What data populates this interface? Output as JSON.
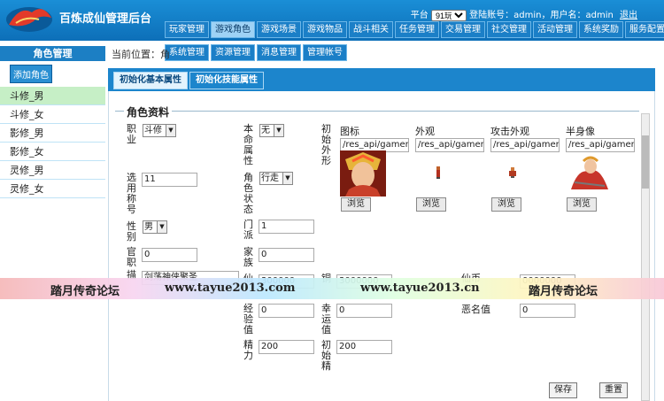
{
  "app": {
    "title": "百炼成仙管理后台"
  },
  "topbar": {
    "platform_label": "平台",
    "platform_value": "91玩",
    "login_label": "登陆账号：admin，用户名：admin",
    "logout": "退出"
  },
  "nav": {
    "row1": [
      "玩家管理",
      "游戏角色",
      "游戏场景",
      "游戏物品",
      "战斗相关",
      "任务管理",
      "交易管理",
      "社交管理",
      "活动管理",
      "系统奖励",
      "服务配置"
    ],
    "row2": [
      "系统管理",
      "资源管理",
      "消息管理",
      "管理帐号"
    ],
    "active": "游戏角色"
  },
  "sidebar": {
    "title": "角色管理",
    "add_button": "添加角色",
    "items": [
      "斗修_男",
      "斗修_女",
      "影修_男",
      "影修_女",
      "灵修_男",
      "灵修_女"
    ],
    "active_item": "斗修_男"
  },
  "main": {
    "breadcrumb": "当前位置：角",
    "tabs": [
      "初始化基本属性",
      "初始化技能属性"
    ],
    "active_tab": "初始化基本属性",
    "section_title": "角色资料",
    "fields": {
      "profession_label": "职业",
      "profession_value": "斗修",
      "element_label": "本命属性",
      "element_value": "无",
      "appearance_label": "初始外形",
      "title_label": "选用称号",
      "title_value": "11",
      "status_label": "角色状态",
      "status_value": "行走",
      "gender_label": "性别",
      "gender_value": "男",
      "sect_label": "门派",
      "sect_value": "1",
      "rank_label": "官职",
      "rank_value": "0",
      "family_label": "家族",
      "family_value": "0",
      "desc_label": "描",
      "desc_value": "剑荡神侠聚圣",
      "xian_label": "仙",
      "xian_value": "300000",
      "tong_label": "铜",
      "tong_value": "3000000",
      "xianbi_label": "仙币",
      "xianbi_value": "0000000",
      "exp_label": "经验值",
      "exp_value": "0",
      "luck_label": "幸运值",
      "luck_value": "0",
      "infamy_label": "恶名值",
      "infamy_value": "0",
      "energy_label": "精力",
      "energy_value": "200",
      "init_label": "初始精",
      "init_value": "200"
    },
    "assets": [
      {
        "label": "图标",
        "path": "/res_api/gamere",
        "button": "浏览"
      },
      {
        "label": "外观",
        "path": "/res_api/gamere",
        "button": "浏览"
      },
      {
        "label": "攻击外观",
        "path": "/res_api/gamere",
        "button": "浏览"
      },
      {
        "label": "半身像",
        "path": "/res_api/gamere",
        "button": "浏览"
      }
    ],
    "save_button": "保存",
    "reset_button": "重置"
  },
  "watermark": {
    "left": "踏月传奇论坛",
    "url1": "www.tayue2013.com",
    "url2": "www.tayue2013.cn",
    "right": "踏月传奇论坛"
  }
}
